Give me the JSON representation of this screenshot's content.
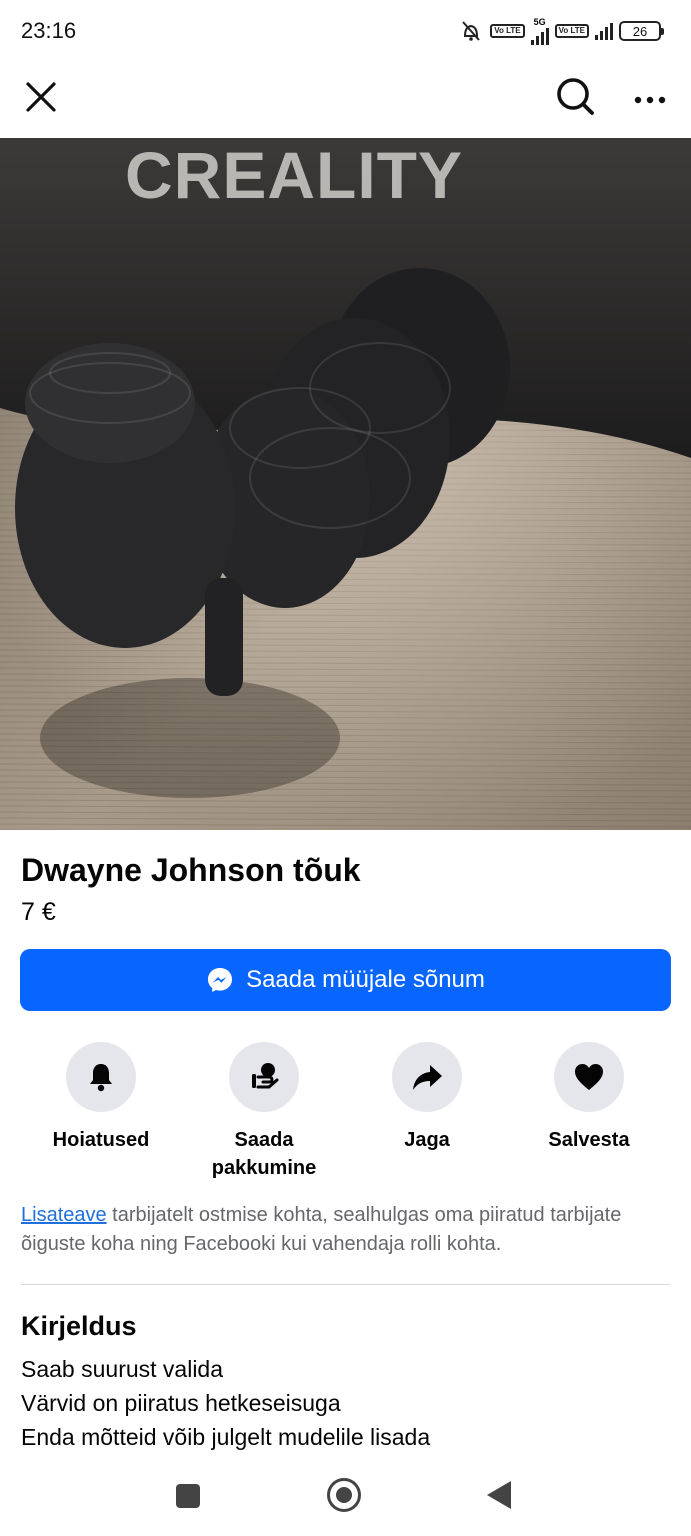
{
  "status_bar": {
    "time": "23:16",
    "network": "5G",
    "volte_1": "Vo LTE",
    "volte_2": "Vo LTE",
    "battery": "26"
  },
  "top_bar": {
    "close_icon": "close-icon",
    "search_icon": "search-icon",
    "more_icon": "more-icon"
  },
  "photo": {
    "brand_text": "CREALITY",
    "page_count": 3,
    "active_page": 2
  },
  "listing": {
    "title": "Dwayne Johnson tõuk",
    "price": "7 €",
    "message_button": "Saada müüjale sõnum"
  },
  "actions": [
    {
      "label": "Hoiatused",
      "icon": "bell-icon"
    },
    {
      "label": "Saada pakkumine",
      "icon": "offer-icon"
    },
    {
      "label": "Jaga",
      "icon": "share-icon"
    },
    {
      "label": "Salvesta",
      "icon": "heart-icon"
    }
  ],
  "info": {
    "link": "Lisateave",
    "text": " tarbijatelt ostmise kohta, sealhulgas oma piiratud tarbijate õiguste koha ning Facebooki kui vahendaja rolli kohta."
  },
  "description": {
    "title": "Kirjeldus",
    "lines": [
      "Saab suurust valida",
      "Värvid on piiratus hetkeseisuga",
      "Enda mõtteid võib julgelt mudelile lisada"
    ]
  },
  "colors": {
    "accent": "#0866ff",
    "link": "#216fdb",
    "secondary_text": "#65676b",
    "circle_bg": "#e4e6eb"
  }
}
